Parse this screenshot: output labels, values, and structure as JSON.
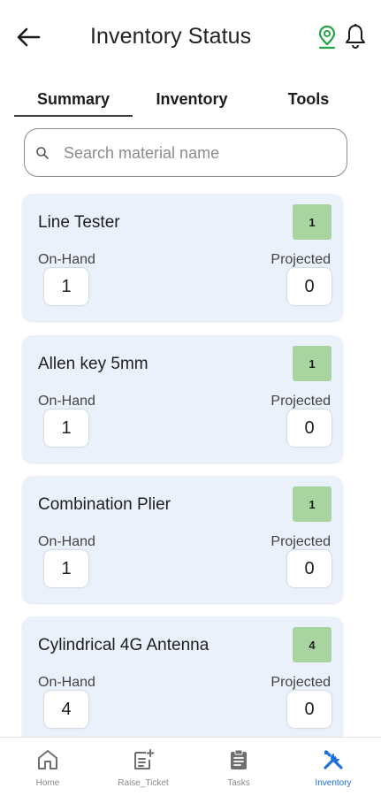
{
  "header": {
    "title": "Inventory Status",
    "back_icon": "arrow-left-icon",
    "location_icon": "location-pin-icon",
    "bell_icon": "bell-icon",
    "location_color": "#22a447"
  },
  "tabs": [
    {
      "label": "Summary",
      "active": true
    },
    {
      "label": "Inventory",
      "active": false
    },
    {
      "label": "Tools",
      "active": false
    }
  ],
  "search": {
    "placeholder": "Search material name",
    "value": ""
  },
  "labels": {
    "on_hand": "On-Hand",
    "projected": "Projected"
  },
  "items": [
    {
      "name": "Line Tester",
      "badge": "1",
      "on_hand": "1",
      "projected": "0"
    },
    {
      "name": "Allen key 5mm",
      "badge": "1",
      "on_hand": "1",
      "projected": "0"
    },
    {
      "name": "Combination Plier",
      "badge": "1",
      "on_hand": "1",
      "projected": "0"
    },
    {
      "name": "Cylindrical 4G Antenna",
      "badge": "4",
      "on_hand": "4",
      "projected": "0"
    }
  ],
  "bottom_nav": [
    {
      "label": "Home",
      "icon": "home-icon",
      "active": false
    },
    {
      "label": "Raise_Ticket",
      "icon": "raise-ticket-icon",
      "active": false
    },
    {
      "label": "Tasks",
      "icon": "clipboard-icon",
      "active": false
    },
    {
      "label": "Inventory",
      "icon": "tools-icon",
      "active": true
    }
  ],
  "colors": {
    "card_bg": "#eaf1fb",
    "badge_bg": "#a8d4a0",
    "active_nav": "#1e6fe0",
    "inactive_nav": "#8a8a8a"
  }
}
